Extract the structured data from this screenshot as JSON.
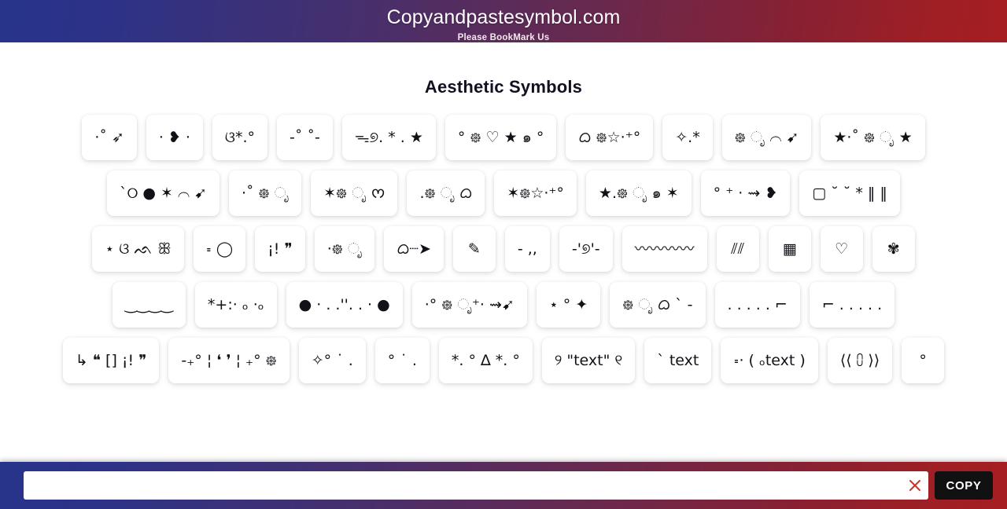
{
  "header": {
    "title": "Copyandpastesymbol.com",
    "subtitle": "Please BookMark Us",
    "gradient_start": "#26348a",
    "gradient_end": "#a51e22"
  },
  "page": {
    "title": "Aesthetic Symbols"
  },
  "symbols": [
    {
      "text": "·˚ ➶"
    },
    {
      "text": "· ❥ ·"
    },
    {
      "text": "ଓ*.°"
    },
    {
      "text": "-˚ ˚-"
    },
    {
      "text": "ᯓ୭. * . ★"
    },
    {
      "text": "° ᪥ ♡ ★ ๑ °"
    },
    {
      "text": "ᜊ ᪥☆·⁺°"
    },
    {
      "text": "✧.*"
    },
    {
      "text": "᪥ ೃ ⌒ ➹"
    },
    {
      "text": "★·˚ ᪥ ೃ ★"
    },
    {
      "text": "ˋ୦ ● ✶ ⌒ ➹"
    },
    {
      "text": "·˚ ᪥ ೃ"
    },
    {
      "text": "✶᪥ ೃ ᰔ"
    },
    {
      "text": ".᪥ ೃ ᜊ"
    },
    {
      "text": "✶᪥☆·⁺°"
    },
    {
      "text": "★.᪥ ೃ ๑ ✶"
    },
    {
      "text": "° ⁺ · ⇝ ❥"
    },
    {
      "text": "▢ ˘ ˘ * ‖ ‖"
    },
    {
      "text": "⋆ ଓ ᨒ ꕥ"
    },
    {
      "text": "꞊ ◯"
    },
    {
      "text": "¡! ❞"
    },
    {
      "text": "·᪥ ೃ"
    },
    {
      "text": "ᜊ┈➤"
    },
    {
      "text": "✎"
    },
    {
      "text": "- ,,"
    },
    {
      "text": "-'୭'-"
    },
    {
      "text": "〰〰〰〰"
    },
    {
      "text": "⫽⫽"
    },
    {
      "text": "▦"
    },
    {
      "text": "♡"
    },
    {
      "text": "✾"
    },
    {
      "text": "‿‿‿‿"
    },
    {
      "text": "*+:· ₒ ·ₒ"
    },
    {
      "text": "● · . .''. . · ●"
    },
    {
      "text": "·° ᪥ ೃ⁺· ⇝➹"
    },
    {
      "text": "⋆ ° ✦"
    },
    {
      "text": "᪥ ೃ ᜊ ˋ -"
    },
    {
      "text": ". . . . .   ⌐"
    },
    {
      "text": "⌐   . . . . ."
    },
    {
      "text": "↳ ❝ [] ¡! ❞"
    },
    {
      "text": "-₊° ¦ ❛ ❜ ¦ ₊° ᪥"
    },
    {
      "text": "✧° ˙ ."
    },
    {
      "text": "° ˙ ."
    },
    {
      "text": "*. ° ∆ *. °"
    },
    {
      "text": "୨ \"text\" ୧"
    },
    {
      "text": "ˋ text"
    },
    {
      "text": "꞊· ( ₒtext )"
    },
    {
      "text": "⟨⟨ ⩇ ⟩⟩"
    },
    {
      "text": "°"
    }
  ],
  "copy_bar": {
    "input_value": "",
    "input_placeholder": "",
    "clear_icon": "close-x-icon",
    "clear_icon_color": "#c0392b",
    "copy_label": "COPY",
    "copy_bg": "#111111"
  }
}
